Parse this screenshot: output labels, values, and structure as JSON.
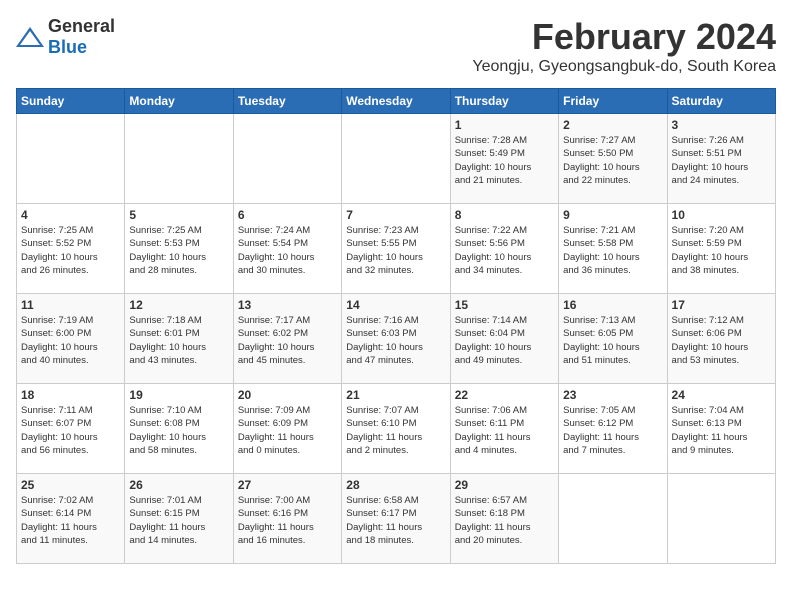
{
  "header": {
    "logo_general": "General",
    "logo_blue": "Blue",
    "month_title": "February 2024",
    "location": "Yeongju, Gyeongsangbuk-do, South Korea"
  },
  "days_of_week": [
    "Sunday",
    "Monday",
    "Tuesday",
    "Wednesday",
    "Thursday",
    "Friday",
    "Saturday"
  ],
  "weeks": [
    [
      {
        "day": "",
        "info": ""
      },
      {
        "day": "",
        "info": ""
      },
      {
        "day": "",
        "info": ""
      },
      {
        "day": "",
        "info": ""
      },
      {
        "day": "1",
        "info": "Sunrise: 7:28 AM\nSunset: 5:49 PM\nDaylight: 10 hours\nand 21 minutes."
      },
      {
        "day": "2",
        "info": "Sunrise: 7:27 AM\nSunset: 5:50 PM\nDaylight: 10 hours\nand 22 minutes."
      },
      {
        "day": "3",
        "info": "Sunrise: 7:26 AM\nSunset: 5:51 PM\nDaylight: 10 hours\nand 24 minutes."
      }
    ],
    [
      {
        "day": "4",
        "info": "Sunrise: 7:25 AM\nSunset: 5:52 PM\nDaylight: 10 hours\nand 26 minutes."
      },
      {
        "day": "5",
        "info": "Sunrise: 7:25 AM\nSunset: 5:53 PM\nDaylight: 10 hours\nand 28 minutes."
      },
      {
        "day": "6",
        "info": "Sunrise: 7:24 AM\nSunset: 5:54 PM\nDaylight: 10 hours\nand 30 minutes."
      },
      {
        "day": "7",
        "info": "Sunrise: 7:23 AM\nSunset: 5:55 PM\nDaylight: 10 hours\nand 32 minutes."
      },
      {
        "day": "8",
        "info": "Sunrise: 7:22 AM\nSunset: 5:56 PM\nDaylight: 10 hours\nand 34 minutes."
      },
      {
        "day": "9",
        "info": "Sunrise: 7:21 AM\nSunset: 5:58 PM\nDaylight: 10 hours\nand 36 minutes."
      },
      {
        "day": "10",
        "info": "Sunrise: 7:20 AM\nSunset: 5:59 PM\nDaylight: 10 hours\nand 38 minutes."
      }
    ],
    [
      {
        "day": "11",
        "info": "Sunrise: 7:19 AM\nSunset: 6:00 PM\nDaylight: 10 hours\nand 40 minutes."
      },
      {
        "day": "12",
        "info": "Sunrise: 7:18 AM\nSunset: 6:01 PM\nDaylight: 10 hours\nand 43 minutes."
      },
      {
        "day": "13",
        "info": "Sunrise: 7:17 AM\nSunset: 6:02 PM\nDaylight: 10 hours\nand 45 minutes."
      },
      {
        "day": "14",
        "info": "Sunrise: 7:16 AM\nSunset: 6:03 PM\nDaylight: 10 hours\nand 47 minutes."
      },
      {
        "day": "15",
        "info": "Sunrise: 7:14 AM\nSunset: 6:04 PM\nDaylight: 10 hours\nand 49 minutes."
      },
      {
        "day": "16",
        "info": "Sunrise: 7:13 AM\nSunset: 6:05 PM\nDaylight: 10 hours\nand 51 minutes."
      },
      {
        "day": "17",
        "info": "Sunrise: 7:12 AM\nSunset: 6:06 PM\nDaylight: 10 hours\nand 53 minutes."
      }
    ],
    [
      {
        "day": "18",
        "info": "Sunrise: 7:11 AM\nSunset: 6:07 PM\nDaylight: 10 hours\nand 56 minutes."
      },
      {
        "day": "19",
        "info": "Sunrise: 7:10 AM\nSunset: 6:08 PM\nDaylight: 10 hours\nand 58 minutes."
      },
      {
        "day": "20",
        "info": "Sunrise: 7:09 AM\nSunset: 6:09 PM\nDaylight: 11 hours\nand 0 minutes."
      },
      {
        "day": "21",
        "info": "Sunrise: 7:07 AM\nSunset: 6:10 PM\nDaylight: 11 hours\nand 2 minutes."
      },
      {
        "day": "22",
        "info": "Sunrise: 7:06 AM\nSunset: 6:11 PM\nDaylight: 11 hours\nand 4 minutes."
      },
      {
        "day": "23",
        "info": "Sunrise: 7:05 AM\nSunset: 6:12 PM\nDaylight: 11 hours\nand 7 minutes."
      },
      {
        "day": "24",
        "info": "Sunrise: 7:04 AM\nSunset: 6:13 PM\nDaylight: 11 hours\nand 9 minutes."
      }
    ],
    [
      {
        "day": "25",
        "info": "Sunrise: 7:02 AM\nSunset: 6:14 PM\nDaylight: 11 hours\nand 11 minutes."
      },
      {
        "day": "26",
        "info": "Sunrise: 7:01 AM\nSunset: 6:15 PM\nDaylight: 11 hours\nand 14 minutes."
      },
      {
        "day": "27",
        "info": "Sunrise: 7:00 AM\nSunset: 6:16 PM\nDaylight: 11 hours\nand 16 minutes."
      },
      {
        "day": "28",
        "info": "Sunrise: 6:58 AM\nSunset: 6:17 PM\nDaylight: 11 hours\nand 18 minutes."
      },
      {
        "day": "29",
        "info": "Sunrise: 6:57 AM\nSunset: 6:18 PM\nDaylight: 11 hours\nand 20 minutes."
      },
      {
        "day": "",
        "info": ""
      },
      {
        "day": "",
        "info": ""
      }
    ]
  ]
}
